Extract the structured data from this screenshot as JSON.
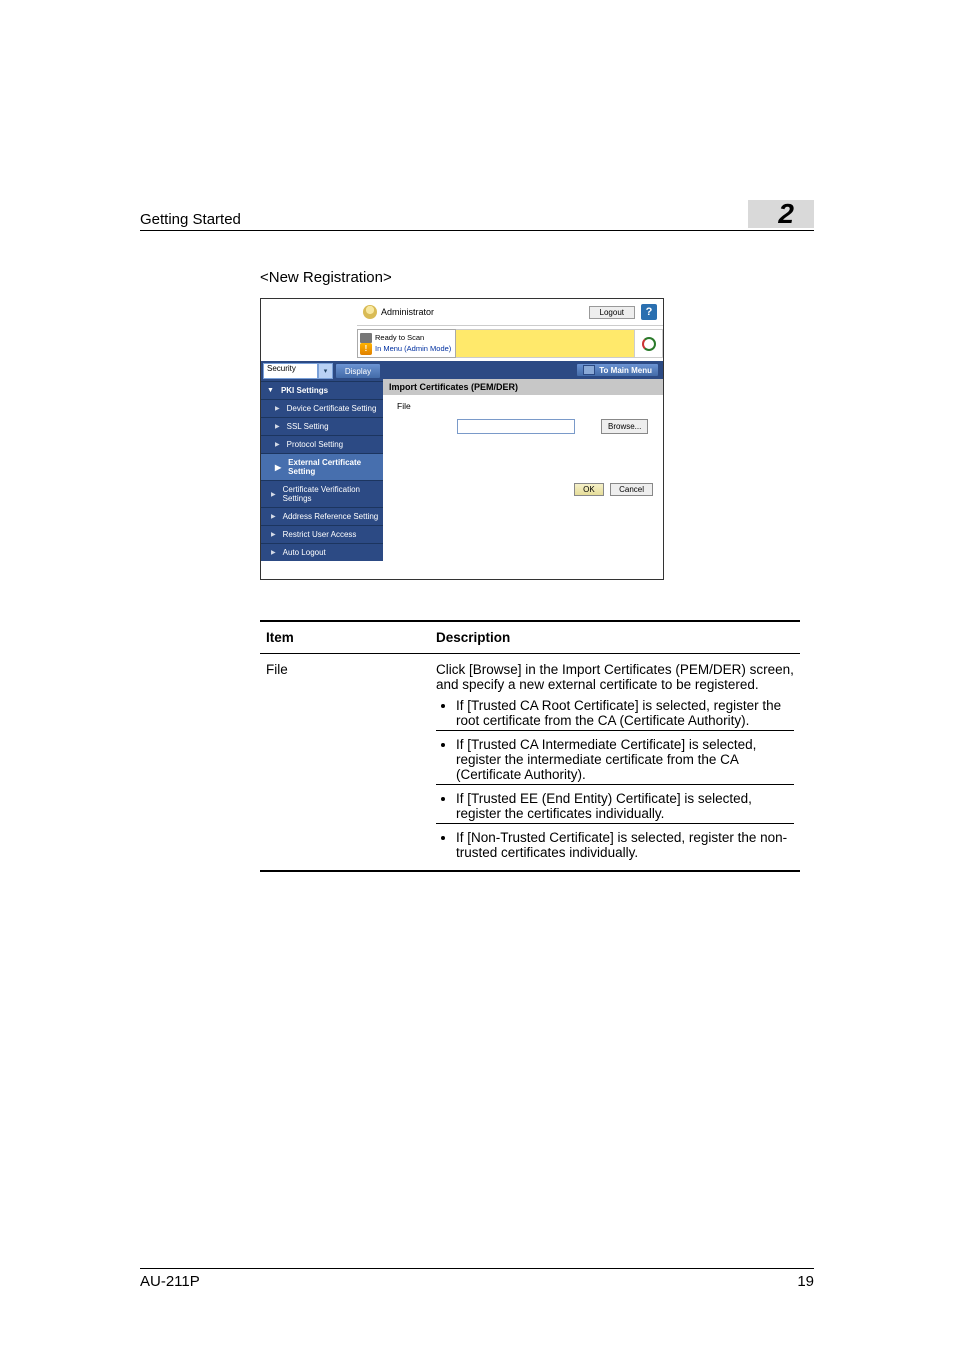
{
  "header": {
    "title": "Getting Started",
    "chapter": "2"
  },
  "subheading": "<New Registration>",
  "screenshot": {
    "admin_label": "Administrator",
    "logout": "Logout",
    "help": "?",
    "status_ready": "Ready to Scan",
    "status_mode": "In Menu (Admin Mode)",
    "sidebar_select": "Security",
    "display_btn": "Display",
    "to_main_menu": "To Main Menu",
    "panel_title": "Import Certificates (PEM/DER)",
    "file_label": "File",
    "browse": "Browse...",
    "ok": "OK",
    "cancel": "Cancel",
    "nav": {
      "pki": "PKI Settings",
      "device_cert": "Device Certificate Setting",
      "ssl": "SSL Setting",
      "protocol": "Protocol Setting",
      "ext_cert": "External Certificate Setting",
      "cert_verify": "Certificate Verification Settings",
      "addr_ref": "Address Reference Setting",
      "restrict": "Restrict User Access",
      "auto_logout": "Auto Logout"
    }
  },
  "table": {
    "head_item": "Item",
    "head_desc": "Description",
    "row_item": "File",
    "intro": "Click [Browse] in the Import Certificates (PEM/DER) screen, and specify a new external certificate to be registered.",
    "b1": "If [Trusted CA Root Certificate] is selected, register the root certificate from the CA (Certificate Authority).",
    "b2": "If [Trusted CA Intermediate Certificate] is selected, register the intermediate certificate from the CA (Certificate Authority).",
    "b3": "If [Trusted EE (End Entity) Certificate] is selected, register the certificates individually.",
    "b4": "If [Non-Trusted Certificate] is selected, register the non-trusted certificates individually."
  },
  "footer": {
    "model": "AU-211P",
    "page": "19"
  }
}
